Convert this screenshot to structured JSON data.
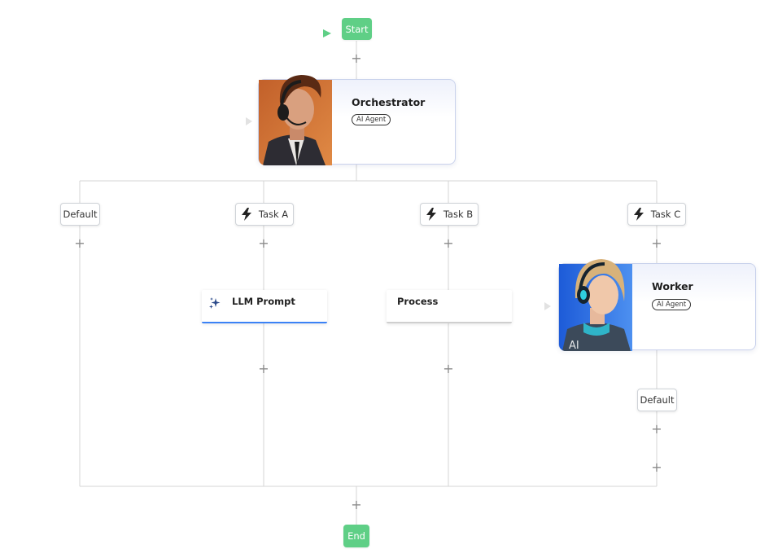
{
  "flow": {
    "start_label": "Start",
    "end_label": "End",
    "orchestrator": {
      "title": "Orchestrator",
      "badge": "AI Agent"
    },
    "worker": {
      "title": "Worker",
      "badge": "AI Agent",
      "avatar_text": "AI"
    },
    "branches": [
      {
        "label": "Default",
        "icon": ""
      },
      {
        "label": "Task A",
        "icon": "lightning-icon"
      },
      {
        "label": "Task B",
        "icon": "lightning-icon"
      },
      {
        "label": "Task C",
        "icon": "lightning-icon"
      }
    ],
    "llm_prompt": {
      "label": "LLM Prompt",
      "icon": "sparkle-icon"
    },
    "process": {
      "label": "Process"
    },
    "worker_branch": {
      "label": "Default"
    },
    "add_symbol": "+"
  },
  "colors": {
    "start_end": "#5fcf86",
    "line": "#d4d4d4",
    "agent_border": "#c9d2ec",
    "llm_accent": "#3b82f6",
    "plus": "#8a8a8a"
  }
}
